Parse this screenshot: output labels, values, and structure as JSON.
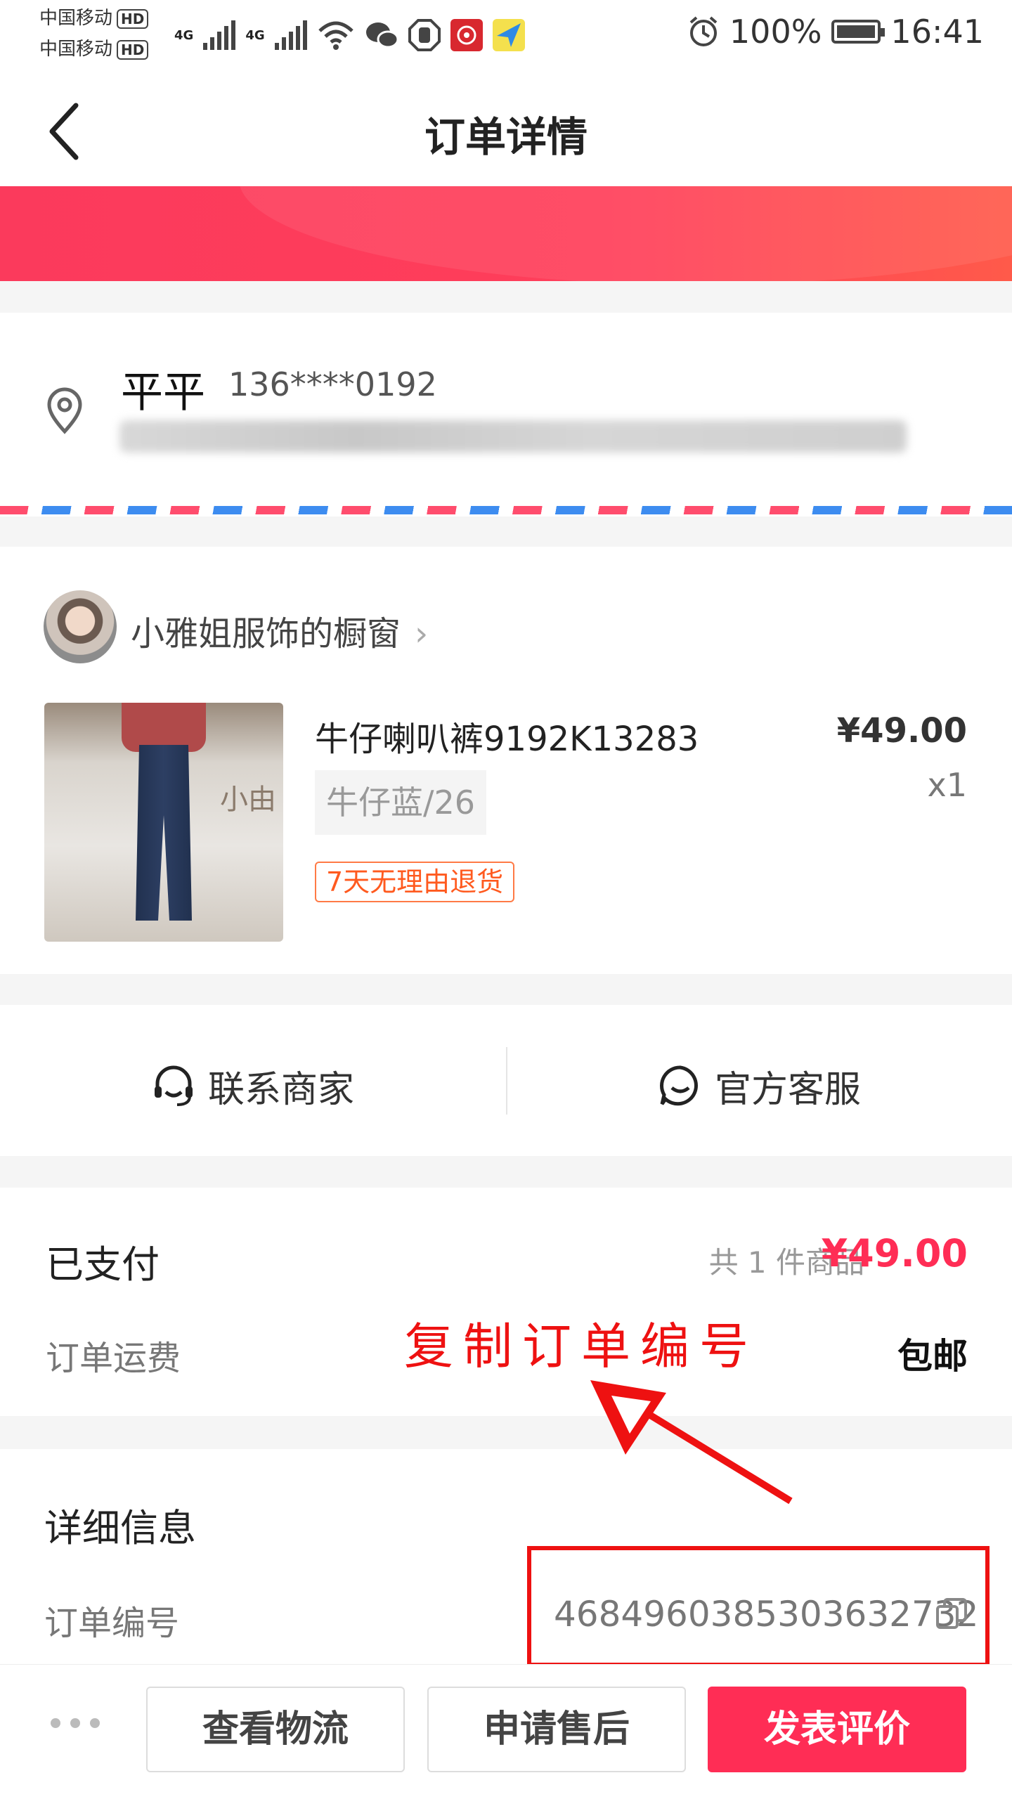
{
  "status_bar": {
    "carrier_1": "中国移动",
    "carrier_2": "中国移动",
    "hd": "HD",
    "net": "4G",
    "battery": "100%",
    "time": "16:41"
  },
  "header": {
    "title": "订单详情",
    "back_icon": "chevron-left-icon"
  },
  "address": {
    "name": "平平",
    "phone": "136****0192",
    "icon": "location-pin-icon"
  },
  "shop": {
    "name": "小雅姐服饰的橱窗",
    "chevron": "›"
  },
  "product": {
    "title": "牛仔喇叭裤9192K13283",
    "spec": "牛仔蓝/26",
    "tag": "7天无理由退货",
    "price": "¥49.00",
    "qty": "x1",
    "image_logo": "小由"
  },
  "contact": {
    "merchant": "联系商家",
    "official": "官方客服"
  },
  "payment": {
    "status": "已支付",
    "count": "共 1 件商品",
    "total": "¥49.00",
    "freight_label": "订单运费",
    "freight_value": "包邮"
  },
  "annotation": {
    "text": "复制订单编号",
    "color": "#ee1111"
  },
  "details": {
    "title": "详细信息",
    "order_no_label": "订单编号",
    "order_no": "4684960385303632732"
  },
  "bottom_bar": {
    "logistics": "查看物流",
    "after_sale": "申请售后",
    "review": "发表评价"
  },
  "colors": {
    "accent": "#ff2d55",
    "tag": "#ff5a1f"
  }
}
